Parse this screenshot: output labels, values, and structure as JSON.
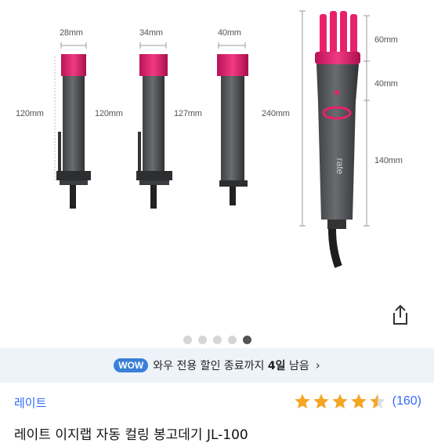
{
  "product_image": {
    "alt": "레이트 자동 컬링 봉고데기 제품 이미지",
    "dimensions": {
      "barrel_1_width": "28mm",
      "barrel_1_length": "120mm",
      "barrel_2_width": "34mm",
      "barrel_2_length": "120mm",
      "barrel_3_width": "40mm",
      "barrel_3_length": "127mm",
      "total_length": "240mm",
      "tip": "60mm",
      "middle": "40mm",
      "handle": "140mm"
    },
    "logo_text": "rate"
  },
  "carousel": {
    "total": 5,
    "active_index": 4
  },
  "wow": {
    "badge": "WOW",
    "text_prefix": "와우 전용 할인 종료까지 ",
    "text_bold": "4일",
    "text_suffix": " 남음",
    "arrow": "›"
  },
  "product": {
    "brand": "레이트",
    "rating": 4.5,
    "review_count": "(160)",
    "title": "레이트 이지랩 자동 컬링 봉고데기 JL-100"
  },
  "colors": {
    "accent_pink": "#e8216b",
    "body_gray": "#5b5d60",
    "star": "#f5a623",
    "link_blue": "#346aff",
    "wow_blue": "#3a80d6"
  },
  "icons": {
    "share": "share-icon",
    "star": "star-icon",
    "chevron": "chevron-right-icon"
  }
}
